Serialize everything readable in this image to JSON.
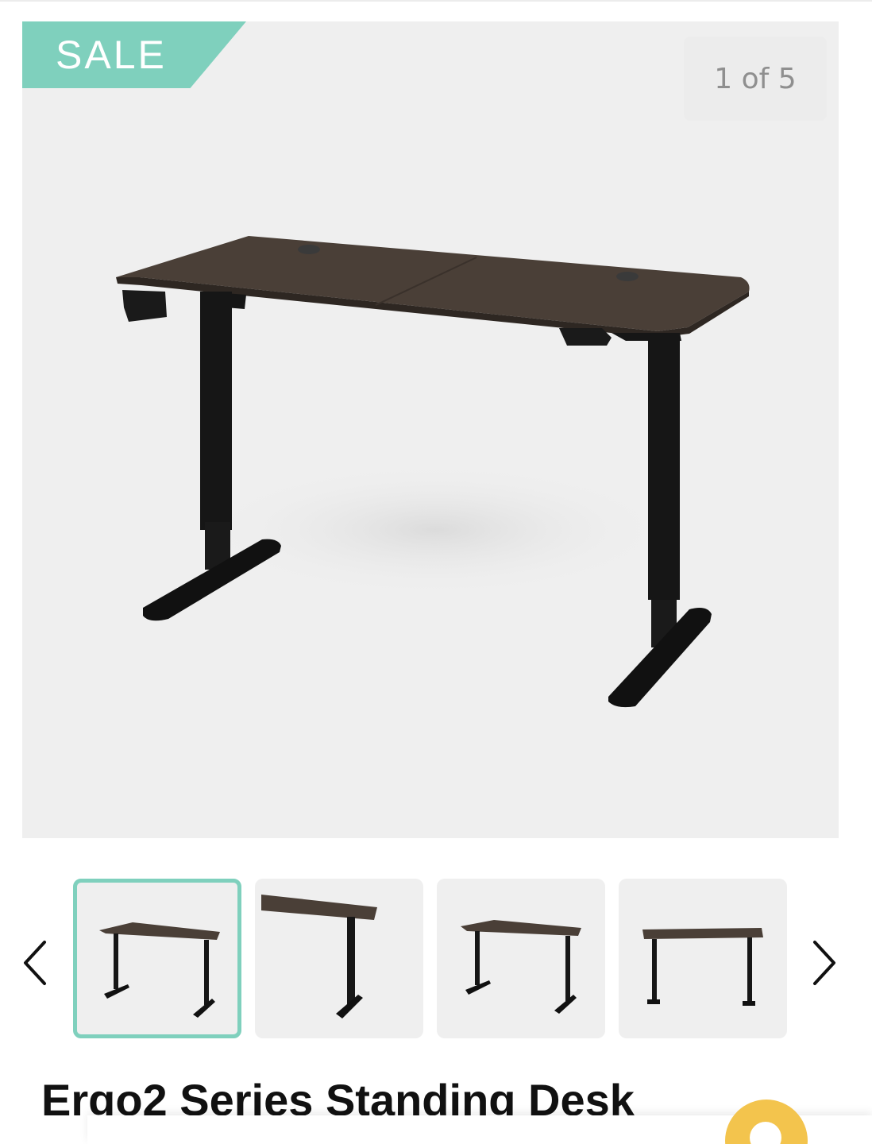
{
  "badge": {
    "sale_label": "SALE"
  },
  "gallery": {
    "counter": "1 of 5",
    "current_index": 1,
    "total": 5,
    "thumbnails": [
      {
        "name": "thumbnail-1",
        "active": true
      },
      {
        "name": "thumbnail-2",
        "active": false
      },
      {
        "name": "thumbnail-3",
        "active": false
      },
      {
        "name": "thumbnail-4",
        "active": false
      }
    ]
  },
  "product": {
    "title": "Ergo2 Series Standing Desk"
  },
  "colors": {
    "accent": "#7fd0bd",
    "chat_button": "#f3c44d",
    "image_background": "#efefef",
    "desktop": "#4a3f37",
    "frame": "#161616"
  },
  "icons": {
    "prev": "chevron-left-icon",
    "next": "chevron-right-icon",
    "chat": "chat-icon"
  }
}
